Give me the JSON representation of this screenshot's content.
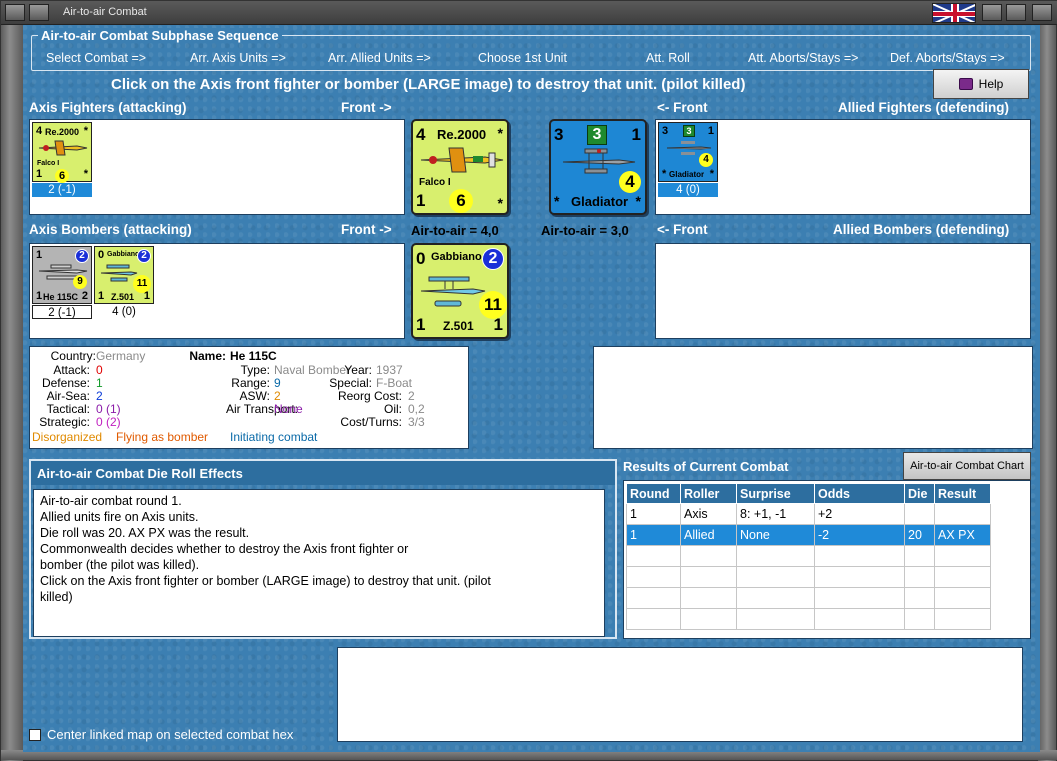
{
  "window": {
    "title": "Air-to-air Combat"
  },
  "subphase": {
    "title": "Air-to-air Combat Subphase Sequence",
    "items": [
      "Select Combat =>",
      "Arr. Axis Units =>",
      "Arr. Allied Units =>",
      "Choose 1st Unit",
      "Att. Roll",
      "Att. Aborts/Stays =>",
      "Def. Aborts/Stays =>"
    ]
  },
  "instruction": "Click on the Axis front fighter or bomber (LARGE image) to destroy that unit. (pilot killed)",
  "help_label": "Help",
  "labels": {
    "axis_fighters": "Axis Fighters (attacking)",
    "front_right": "Front ->",
    "front_left": "<- Front",
    "allied_fighters": "Allied Fighters (defending)",
    "axis_bombers": "Axis Bombers (attacking)",
    "allied_bombers": "Allied Bombers (defending)",
    "axis_air_to_air": "Air-to-air = 4,0",
    "allied_air_to_air": "Air-to-air = 3,0"
  },
  "axis_fighters": [
    {
      "name": "Re.2000",
      "sub": "Falco I",
      "tl": "4",
      "tr": "*",
      "bl": "1",
      "br": "*",
      "circle": "6",
      "value": "2 (-1)"
    }
  ],
  "allied_fighters": [
    {
      "name": "Gladiator",
      "tl": "3",
      "square": "3",
      "tr": "1",
      "bl": "*",
      "br": "*",
      "circle": "4",
      "value": "4 (0)"
    }
  ],
  "axis_bombers": [
    {
      "name": "He 115C",
      "tl": "1",
      "tr": "2",
      "bl": "1",
      "br": "2",
      "circle": "9",
      "value": "2 (-1)"
    },
    {
      "name": "Z.501",
      "sub": "Gabbiano",
      "tl": "0",
      "tr": "2",
      "bl": "1",
      "br": "1",
      "circle": "11",
      "value": "4 (0)"
    }
  ],
  "front_axis_fighter": {
    "name": "Re.2000",
    "sub": "Falco I",
    "tl": "4",
    "tr": "*",
    "bl": "1",
    "circle": "6",
    "br": "*"
  },
  "front_allied_fighter": {
    "name": "Gladiator",
    "tl": "3",
    "square": "3",
    "tr": "1",
    "circle": "4",
    "bl": "*",
    "br": "*"
  },
  "front_axis_bomber": {
    "name": "Gabbiano",
    "sub": "Z.501",
    "tl": "0",
    "tr": "2",
    "bl": "1",
    "br": "1",
    "circle": "11"
  },
  "info": {
    "country_label": "Country:",
    "country": "Germany",
    "attack_label": "Attack:",
    "attack": "0",
    "defense_label": "Defense:",
    "defense": "1",
    "airsea_label": "Air-Sea:",
    "airsea": "2",
    "tactical_label": "Tactical:",
    "tactical": "0 (1)",
    "strategic_label": "Strategic:",
    "strategic": "0 (2)",
    "name_label": "Name:",
    "name": "He 115C",
    "type_label": "Type:",
    "type": "Naval Bomber",
    "year_label": "Year:",
    "year": "1937",
    "range_label": "Range:",
    "range": "9",
    "special_label": "Special:",
    "special": "F-Boat",
    "asw_label": "ASW:",
    "asw": "2",
    "reorg_label": "Reorg Cost:",
    "reorg": "2",
    "airtransport_label": "Air Transport:",
    "airtransport": "None",
    "oil_label": "Oil:",
    "oil": "0,2",
    "cost_label": "Cost/Turns:",
    "cost": "3/3",
    "status_disorganized": "Disorganized",
    "status_flying": "Flying as bomber",
    "status_initiating": "Initiating combat"
  },
  "dieroll": {
    "title": "Air-to-air Combat Die Roll Effects",
    "lines": [
      "Air-to-air combat round 1.",
      "Allied units fire on Axis units.",
      "Die roll was 20.  AX PX was the result.",
      "Commonwealth decides whether to destroy the Axis front fighter or",
      "bomber (the pilot was killed).",
      "Click on the Axis front fighter or bomber (LARGE image) to destroy that unit. (pilot",
      "killed)"
    ]
  },
  "results": {
    "title": "Results of Current Combat",
    "chart_button": "Air-to-air Combat Chart",
    "columns": [
      "Round",
      "Roller",
      "Surprise",
      "Odds",
      "Die",
      "Result"
    ],
    "rows": [
      [
        "1",
        "Axis",
        "8: +1, -1",
        "+2",
        "",
        ""
      ],
      [
        "1",
        "Allied",
        "None",
        "-2",
        "20",
        "AX PX"
      ]
    ]
  },
  "checkbox_label": "Center linked map on selected combat hex",
  "colors": {
    "panel": "#3c7fb2",
    "axis_counter": "#d8ef6e",
    "allied_counter": "#1e87d4",
    "bomber_grey": "#b4b4b4"
  }
}
